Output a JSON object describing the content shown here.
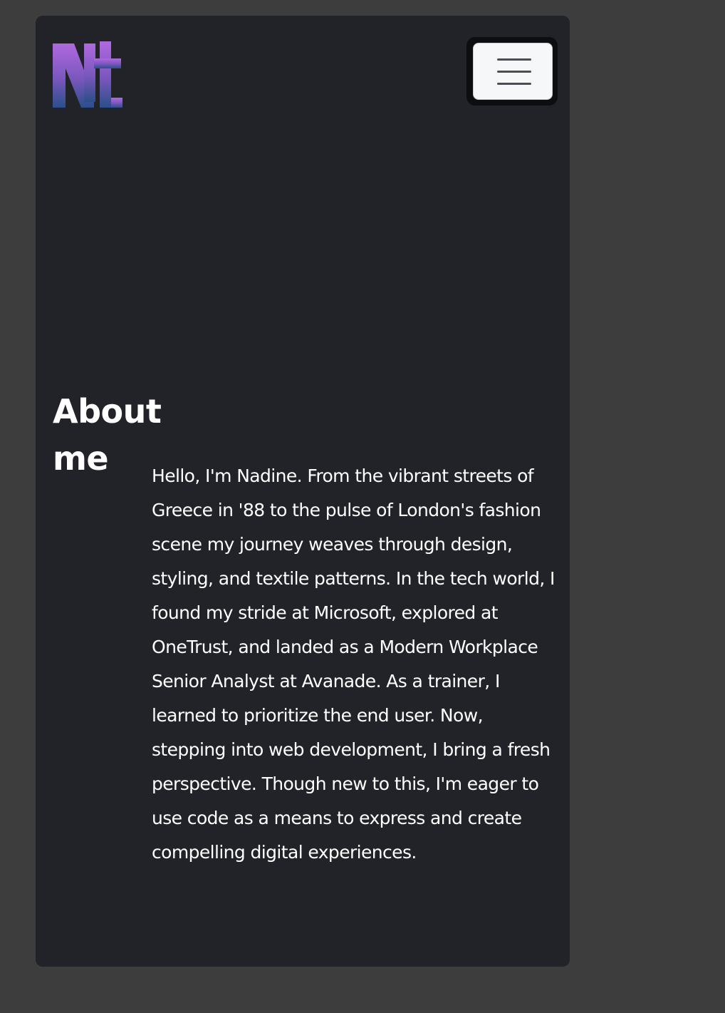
{
  "logo": {
    "text": "Nt",
    "gradient_top": "#b069e0",
    "gradient_bottom": "#2a4f8a"
  },
  "nav": {
    "menu_icon": "hamburger-menu-icon"
  },
  "about": {
    "heading": "About me",
    "body": "Hello, I'm Nadine. From the vibrant streets of Greece in '88 to the pulse of London's fashion scene my journey weaves through design, styling, and textile patterns. In the tech world, I found my stride at Microsoft, explored at OneTrust, and landed as a Modern Workplace Senior Analyst at Avanade. As a trainer, I learned to prioritize the end user. Now, stepping into web development, I bring a fresh perspective. Though new to this, I'm eager to use code as a means to express and create compelling digital experiences."
  },
  "colors": {
    "page_background": "#3d3d3d",
    "card_background": "#212328",
    "text": "#ffffff",
    "menu_button_background": "#f6f7f9"
  }
}
